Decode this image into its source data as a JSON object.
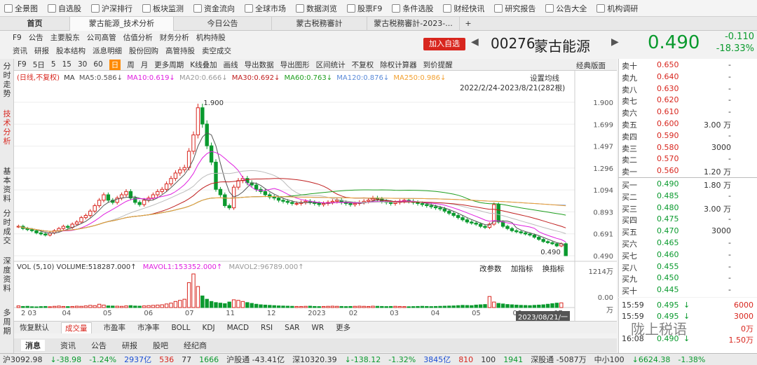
{
  "toolbar": {
    "items": [
      {
        "label": "全景图"
      },
      {
        "label": "自选股"
      },
      {
        "label": "沪深排行"
      },
      {
        "label": "板块监测"
      },
      {
        "label": "资金流向"
      },
      {
        "label": "全球市场"
      },
      {
        "label": "数据浏览"
      },
      {
        "label": "股票F9"
      },
      {
        "label": "条件选股"
      },
      {
        "label": "财经快讯"
      },
      {
        "label": "研究报告"
      },
      {
        "label": "公告大全"
      },
      {
        "label": "机构调研"
      }
    ]
  },
  "tabs": {
    "home": "首页",
    "items": [
      "蒙古能源_技术分析",
      "今日公告",
      "蒙古税務審計",
      "蒙古税務審計-2023-..."
    ],
    "add": "+"
  },
  "subnav": {
    "row1": [
      "F9",
      "公告",
      "主要股东",
      "公司高管",
      "估值分析",
      "财务分析",
      "机构持股"
    ],
    "row2": [
      "资讯",
      "研报",
      "股本结构",
      "派息明细",
      "股份回购",
      "高管持股",
      "卖空成交"
    ]
  },
  "stock": {
    "add_button": "加入自选",
    "code": "00276",
    "name": "蒙古能源",
    "price": "0.490",
    "change": "-0.110",
    "pct": "-18.33%",
    "nav_prev": "◀",
    "nav_next": "▶"
  },
  "vnav": [
    "分时走势",
    "技术分析",
    "基本资料",
    "分时成交",
    "深度资料",
    "多周期"
  ],
  "chart_toolbar": {
    "items": [
      "F9",
      "5日",
      "5",
      "15",
      "30",
      "60",
      "日",
      "周",
      "月",
      "更多周期",
      "K线叠加",
      "画线",
      "导出数据",
      "导出图形",
      "区间统计",
      "不复权",
      "除权计算器",
      "到价提醒"
    ],
    "classic": "经典版面",
    "ma_setting": "设置均线"
  },
  "ma_legend": {
    "prefix": "(日线,不复权)",
    "ma": "MA",
    "ma5": "MA5:0.586↓",
    "ma10": "MA10:0.619↓",
    "ma20": "MA20:0.666↓",
    "ma30": "MA30:0.692↓",
    "ma60": "MA60:0.763↓",
    "ma120": "MA120:0.876↓",
    "ma250": "MA250:0.986↓"
  },
  "colors": {
    "ma5": "#555555",
    "ma10": "#e020e0",
    "ma20": "#bbbbbb",
    "ma30": "#c02020",
    "ma60": "#1e9e1e",
    "ma120": "#5a8ad8",
    "ma250": "#f2a030",
    "up": "#d8261e",
    "down": "#0a9a2e"
  },
  "date_range": "2022/2/24-2023/8/21(282根)",
  "price_annotations": {
    "high": "1.900",
    "last": "0.490"
  },
  "chart_data": [
    {
      "type": "candlestick",
      "title": "",
      "y_ticks": [
        "1.900",
        "1.699",
        "1.497",
        "1.296",
        "1.094",
        "0.893",
        "0.691",
        "0.490"
      ],
      "ylim": [
        0.49,
        1.9
      ],
      "x_ticks": [
        "2 03",
        "04",
        "05",
        "06",
        "07",
        "11",
        "12",
        "2023",
        "02",
        "03",
        "04",
        "05",
        "06",
        "07"
      ],
      "cursor_date": "2023/08/21/一",
      "close": [
        0.76,
        0.74,
        0.73,
        0.72,
        0.7,
        0.69,
        0.68,
        0.7,
        0.72,
        0.74,
        0.76,
        0.75,
        0.78,
        0.8,
        0.84,
        0.86,
        0.9,
        0.95,
        1.0,
        1.05,
        1.0,
        0.98,
        1.02,
        1.05,
        1.08,
        1.02,
        0.98,
        0.96,
        1.0,
        1.02,
        1.05,
        1.08,
        1.1,
        1.15,
        1.2,
        1.25,
        1.28,
        1.3,
        1.45,
        1.6,
        1.85,
        1.7,
        1.5,
        1.35,
        1.1,
        1.05,
        0.95,
        0.93,
        1.12,
        1.18,
        1.2,
        1.16,
        1.14,
        1.1,
        1.08,
        1.05,
        1.03,
        1.02,
        1.0,
        0.99,
        0.98,
        0.97,
        0.97,
        0.98,
        0.99,
        0.98,
        0.97,
        0.96,
        0.97,
        0.98,
        0.99,
        1.0,
        0.98,
        0.97,
        0.96,
        0.97,
        0.98,
        0.99,
        1.0,
        1.02,
        1.01,
        0.99,
        0.98,
        0.97,
        0.98,
        0.99,
        1.0,
        0.99,
        0.98,
        0.97,
        0.96,
        0.95,
        0.94,
        0.93,
        0.92,
        0.9,
        0.88,
        0.86,
        0.84,
        0.82,
        0.8,
        0.79,
        0.78,
        0.76,
        0.75,
        0.78,
        0.96,
        0.8,
        0.76,
        0.74,
        0.72,
        0.71,
        0.7,
        0.69,
        0.68,
        0.66,
        0.64,
        0.62,
        0.61,
        0.6,
        0.58,
        0.6,
        0.49
      ],
      "ma_series": [
        {
          "name": "MA5",
          "key": "ma5"
        },
        {
          "name": "MA10",
          "key": "ma10"
        },
        {
          "name": "MA20",
          "key": "ma20"
        },
        {
          "name": "MA30",
          "key": "ma30"
        },
        {
          "name": "MA60",
          "key": "ma60"
        },
        {
          "name": "MA120",
          "key": "ma120"
        },
        {
          "name": "MA250",
          "key": "ma250"
        }
      ]
    },
    {
      "type": "bar",
      "title": "",
      "y_ticks": [
        "1214万",
        "0.00",
        "万"
      ],
      "values": [
        60,
        40,
        45,
        30,
        25,
        35,
        40,
        30,
        45,
        55,
        40,
        35,
        40,
        50,
        45,
        60,
        80,
        70,
        120,
        90,
        60,
        55,
        50,
        45,
        60,
        70,
        55,
        50,
        60,
        70,
        80,
        90,
        100,
        130,
        160,
        220,
        260,
        300,
        900,
        1214,
        760,
        420,
        300,
        220,
        180,
        160,
        140,
        200,
        280,
        260,
        220,
        180,
        150,
        120,
        100,
        90,
        80,
        70,
        60,
        55,
        50,
        45,
        40,
        40,
        45,
        50,
        40,
        35,
        40,
        45,
        50,
        45,
        40,
        35,
        40,
        45,
        50,
        45,
        40,
        50,
        45,
        40,
        35,
        40,
        45,
        40,
        35,
        30,
        35,
        40,
        45,
        40,
        35,
        40,
        45,
        50,
        55,
        60,
        70,
        80,
        75,
        70,
        90,
        100,
        110,
        400,
        200,
        150,
        130,
        110,
        100,
        90,
        80,
        75,
        70,
        80,
        90,
        100,
        120,
        140,
        160,
        170
      ]
    }
  ],
  "volume": {
    "legend": "VOL (5,10) VOLUME:518287.000↑",
    "mavol1": "MAVOL1:153352.000↑",
    "mavol2": "MAVOL2:96789.000↑",
    "buttons": [
      "改参数",
      "加指标",
      "换指标"
    ]
  },
  "indicators": {
    "items": [
      "恢复默认",
      "成交量",
      "市盈率",
      "市净率",
      "BOLL",
      "KDJ",
      "MACD",
      "RSI",
      "SAR",
      "WR",
      "更多"
    ],
    "active": "成交量"
  },
  "news_tabs": {
    "items": [
      "消息",
      "资讯",
      "公告",
      "研报",
      "股吧",
      "经纪商"
    ],
    "active": "消息"
  },
  "orderbook": {
    "asks": [
      {
        "label": "卖十",
        "price": "0.650",
        "vol": "-"
      },
      {
        "label": "卖九",
        "price": "0.640",
        "vol": "-"
      },
      {
        "label": "卖八",
        "price": "0.630",
        "vol": "-"
      },
      {
        "label": "卖七",
        "price": "0.620",
        "vol": "-"
      },
      {
        "label": "卖六",
        "price": "0.610",
        "vol": "-"
      },
      {
        "label": "卖五",
        "price": "0.600",
        "vol": "3.00 万"
      },
      {
        "label": "卖四",
        "price": "0.590",
        "vol": "-"
      },
      {
        "label": "卖三",
        "price": "0.580",
        "vol": "3000"
      },
      {
        "label": "卖二",
        "price": "0.570",
        "vol": "-"
      },
      {
        "label": "卖一",
        "price": "0.560",
        "vol": "1.20 万"
      }
    ],
    "bids": [
      {
        "label": "买一",
        "price": "0.490",
        "vol": "1.80 万"
      },
      {
        "label": "买二",
        "price": "0.485",
        "vol": "-"
      },
      {
        "label": "买三",
        "price": "0.480",
        "vol": "3.00 万"
      },
      {
        "label": "买四",
        "price": "0.475",
        "vol": "-"
      },
      {
        "label": "买五",
        "price": "0.470",
        "vol": "3000"
      },
      {
        "label": "买六",
        "price": "0.465",
        "vol": "-"
      },
      {
        "label": "买七",
        "price": "0.460",
        "vol": "-"
      },
      {
        "label": "买八",
        "price": "0.455",
        "vol": "-"
      },
      {
        "label": "买九",
        "price": "0.450",
        "vol": "-"
      },
      {
        "label": "买十",
        "price": "0.445",
        "vol": "-"
      }
    ]
  },
  "trades": [
    {
      "time": "15:59",
      "price": "0.495",
      "dir": "↓",
      "vol": "6000"
    },
    {
      "time": "15:59",
      "price": "0.495",
      "dir": "↓",
      "vol": "3000"
    },
    {
      "time": "",
      "price": "",
      "dir": "",
      "vol": "0万"
    },
    {
      "time": "16:08",
      "price": "0.490",
      "dir": "↓",
      "vol": "1.50万"
    }
  ],
  "watermark": "陇上税语",
  "statusbar": {
    "sh_label": "沪3092.98",
    "sh_chg": "↓-38.98",
    "sh_pct": "-1.24%",
    "sh_amt": "2937亿",
    "sh_up": "536",
    "sh_flat": "77",
    "sh_down": "1666",
    "hgt": "沪股通 -43.41亿",
    "sz_label": "深10320.39",
    "sz_chg": "↓-138.12",
    "sz_pct": "-1.32%",
    "sz_amt": "3845亿",
    "sz_up": "810",
    "sz_flat": "100",
    "sz_down": "1941",
    "sgt": "深股通 -5087万",
    "small": "中小100",
    "small_val": "↓6624.38",
    "small_pct": "-1.38%"
  }
}
